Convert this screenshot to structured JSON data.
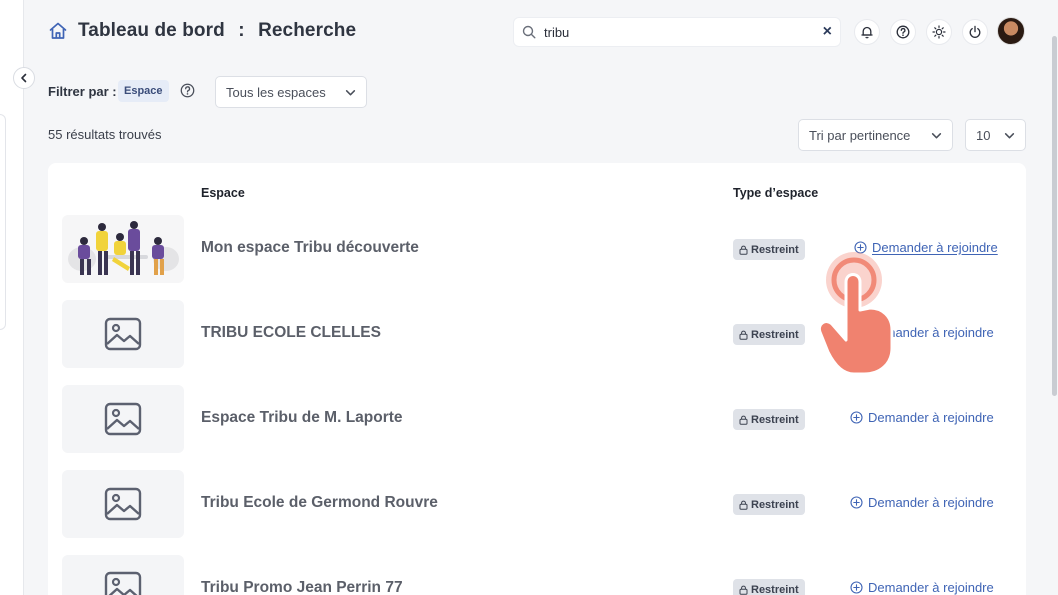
{
  "header": {
    "title_part1": "Tableau de bord",
    "separator": ":",
    "title_part2": "Recherche",
    "search_value": "tribu",
    "clear_label": "×"
  },
  "filter": {
    "label": "Filtrer par :",
    "chip": "Espace",
    "scope_select": "Tous les espaces"
  },
  "results": {
    "count_text": "55 résultats trouvés",
    "sort_select": "Tri par pertinence",
    "page_size_select": "10"
  },
  "table": {
    "columns": [
      "Espace",
      "Type d’espace"
    ],
    "rows": [
      {
        "name": "Mon espace Tribu découverte",
        "type": "Restreint",
        "action": "Demander à rejoindre",
        "thumb": "illustration"
      },
      {
        "name": "TRIBU ECOLE CLELLES",
        "type": "Restreint",
        "action": "Demander à rejoindre",
        "thumb": "placeholder"
      },
      {
        "name": "Espace Tribu de M. Laporte",
        "type": "Restreint",
        "action": "Demander à rejoindre",
        "thumb": "placeholder"
      },
      {
        "name": "Tribu Ecole de Germond Rouvre",
        "type": "Restreint",
        "action": "Demander à rejoindre",
        "thumb": "placeholder"
      },
      {
        "name": "Tribu Promo Jean Perrin 77",
        "type": "Restreint",
        "action": "Demander à rejoindre",
        "thumb": "placeholder"
      }
    ]
  },
  "icons": {
    "home": "home-icon",
    "search": "search-icon",
    "bell": "bell-icon",
    "help": "help-icon",
    "theme": "sun-icon",
    "power": "power-icon",
    "lock": "lock-icon",
    "join": "plus-circle-icon",
    "image": "image-placeholder-icon",
    "tap": "tap-hand-icon"
  },
  "colors": {
    "accent_link": "#3f64b5",
    "badge_bg": "#dfe2e8",
    "chip_bg": "#e6ecf7",
    "tap_overlay": "#f0826f"
  }
}
